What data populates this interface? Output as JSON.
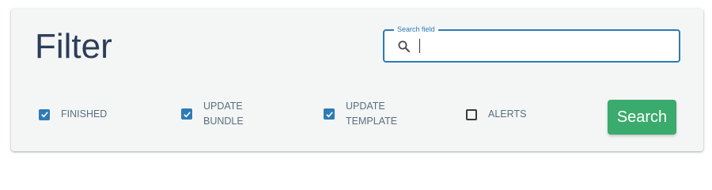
{
  "filter_panel": {
    "title": "Filter",
    "search": {
      "label": "Search field",
      "value": "",
      "icon": "search-icon"
    },
    "options": [
      {
        "label": "FINISHED",
        "checked": true
      },
      {
        "label": "UPDATE\nBUNDLE",
        "checked": true
      },
      {
        "label": "UPDATE\nTEMPLATE",
        "checked": true
      },
      {
        "label": "ALERTS",
        "checked": false
      }
    ],
    "search_button_label": "Search"
  },
  "colors": {
    "title": "#2c3e57",
    "accent_blue": "#2e7bb6",
    "button_green": "#3aaa6d",
    "panel_bg": "#f4f6f6",
    "option_text": "#5b6e80"
  }
}
